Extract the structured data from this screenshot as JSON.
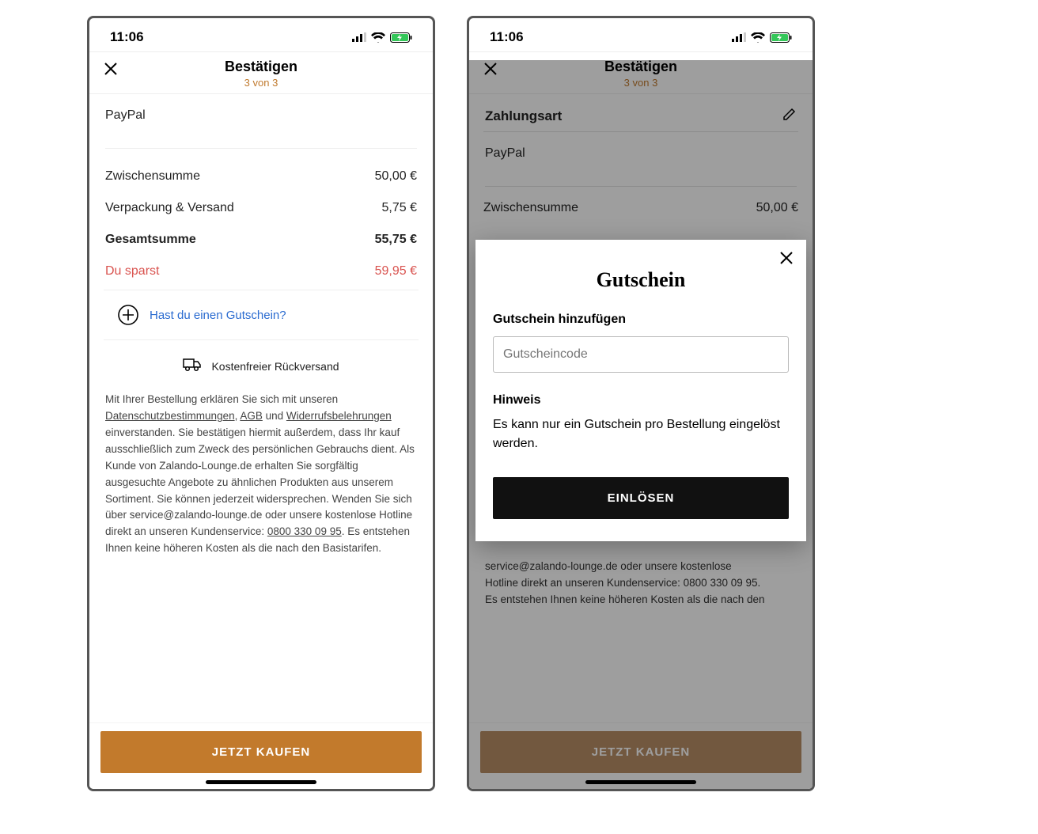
{
  "status": {
    "time": "11:06"
  },
  "nav": {
    "title": "Bestätigen",
    "step": "3 von 3"
  },
  "payment": {
    "method_label": "Zahlungsart",
    "method": "PayPal"
  },
  "summary": {
    "subtotal_label": "Zwischensumme",
    "subtotal_value": "50,00 €",
    "shipping_label": "Verpackung & Versand",
    "shipping_value": "5,75 €",
    "total_label": "Gesamtsumme",
    "total_value": "55,75 €",
    "savings_label": "Du sparst",
    "savings_value": "59,95 €"
  },
  "voucher": {
    "prompt": "Hast du einen Gutschein?"
  },
  "freereturn": {
    "text": "Kostenfreier Rückversand"
  },
  "legal": {
    "pre": "Mit Ihrer Bestellung erklären Sie sich mit unseren ",
    "privacy": "Datenschutzbestimmungen",
    "sep1": ", ",
    "agb": "AGB",
    "sep2": " und ",
    "withdraw": "Widerrufsbelehrungen",
    "mid": " einverstanden. Sie bestätigen hiermit außerdem, dass Ihr kauf ausschließlich zum Zweck des persönlichen Gebrauchs dient. Als Kunde von Zalando-Lounge.de erhalten Sie sorgfältig ausgesuchte Angebote zu ähnlichen Produkten aus unserem Sortiment. Sie können jederzeit widersprechen. Wenden Sie sich über service@zalando-lounge.de oder unsere kostenlose Hotline direkt an unseren Kundenservice: ",
    "phone": "0800 330 09 95",
    "post": ". Es entstehen Ihnen keine höheren Kosten als die nach den Basistarifen."
  },
  "legal2": {
    "line1": "service@zalando-lounge.de oder unsere kostenlose",
    "line2a": "Hotline direkt an unseren Kundenservice: ",
    "phone": "0800 330 09 95",
    "line2b": ".",
    "line3": "Es entstehen Ihnen keine höheren Kosten als die nach den"
  },
  "buy": {
    "label": "JETZT KAUFEN"
  },
  "modal": {
    "title": "Gutschein",
    "add_label": "Gutschein hinzufügen",
    "placeholder": "Gutscheincode",
    "note_heading": "Hinweis",
    "note_text": "Es kann nur ein Gutschein pro Bestellung eingelöst werden.",
    "redeem": "EINLÖSEN"
  }
}
